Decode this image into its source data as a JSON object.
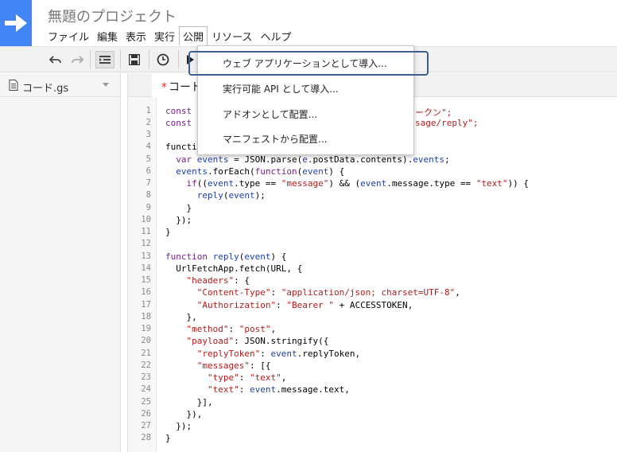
{
  "app": {
    "title": "無題のプロジェクト"
  },
  "menubar": {
    "items": [
      "ファイル",
      "編集",
      "表示",
      "実行",
      "公開",
      "リソース",
      "ヘルプ"
    ],
    "active": "公開"
  },
  "toolbar": {
    "icons": [
      "undo-icon",
      "redo-icon",
      "indent-icon",
      "save-icon",
      "trigger-clock-icon",
      "run-icon"
    ]
  },
  "files": {
    "items": [
      {
        "name": "コード.gs"
      }
    ]
  },
  "tab": {
    "modified_mark": "*",
    "label": "コード"
  },
  "publish_menu": {
    "items": [
      {
        "label": "ウェブ アプリケーションとして導入..."
      },
      {
        "label": "実行可能 API として導入..."
      },
      {
        "label": "アドオンとして配置..."
      },
      {
        "label": "マニフェストから配置..."
      }
    ],
    "highlighted_index": 0
  },
  "code": {
    "line_numbers": [
      "1",
      "2",
      "3",
      "4",
      "5",
      "6",
      "7",
      "8",
      "9",
      "10",
      "11",
      "12",
      "13",
      "14",
      "15",
      "16",
      "17",
      "18",
      "19",
      "20",
      "21",
      "22",
      "23",
      "24",
      "25",
      "26",
      "27",
      "28"
    ],
    "lines": [
      "const ",
      "const ",
      "",
      "functi",
      "  var events = JSON.parse(e.postData.contents).events;",
      "  events.forEach(function(event) {",
      "    if((event.type == \"message\") && (event.message.type == \"text\")) {",
      "      reply(event);",
      "    }",
      "  });",
      "}",
      "",
      "function reply(event) {",
      "  UrlFetchApp.fetch(URL, {",
      "    \"headers\": {",
      "      \"Content-Type\": \"application/json; charset=UTF-8\",",
      "      \"Authorization\": \"Bearer \" + ACCESSTOKEN,",
      "    },",
      "    \"method\": \"post\",",
      "    \"payload\": JSON.stringify({",
      "      \"replyToken\": event.replyToken,",
      "      \"messages\": [{",
      "        \"type\": \"text\",",
      "        \"text\": event.message.text,",
      "      }],",
      "    }),",
      "  });",
      "}"
    ],
    "line1_tail": "ークン\";",
    "line2_tail": "sage/reply\";"
  }
}
